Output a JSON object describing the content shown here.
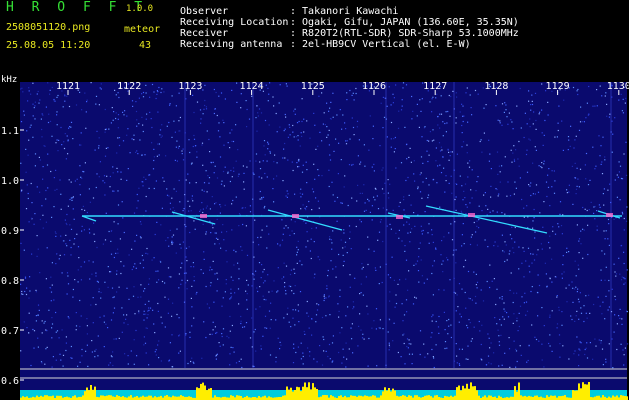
{
  "header": {
    "app_name": "H R O F F T",
    "version": "1.0.0",
    "filename": "2508051120.png",
    "datetime": "25.08.05 11:20",
    "meteor_label": "meteor",
    "meteor_count": "43",
    "info": [
      {
        "label": "Observer",
        "value": ": Takanori Kawachi"
      },
      {
        "label": "Receiving Location",
        "value": ": Ogaki, Gifu, JAPAN (136.60E, 35.35N)"
      },
      {
        "label": "Receiver",
        "value": ": R820T2(RTL-SDR) SDR-Sharp 53.1000MHz"
      },
      {
        "label": "Receiving antenna",
        "value": ": 2el-HB9CV Vertical (el. E-W)"
      }
    ]
  },
  "spectrogram": {
    "unit_label": "kHz",
    "y_ticks": [
      "1.1",
      "1.0",
      "0.9",
      "0.8",
      "0.7",
      "0.6"
    ],
    "x_ticks": [
      "1121",
      "1122",
      "1123",
      "1124",
      "1125",
      "1126",
      "1127",
      "1128",
      "1129",
      "1130"
    ],
    "colors": {
      "background": "#0a0a6e",
      "noise": "#3a5aff",
      "trace": "#33ddff",
      "header_accent": "#e8e820",
      "app_name": "#35e035",
      "level_bar": "#ffee00",
      "level_floor": "#00ccdd"
    }
  }
}
